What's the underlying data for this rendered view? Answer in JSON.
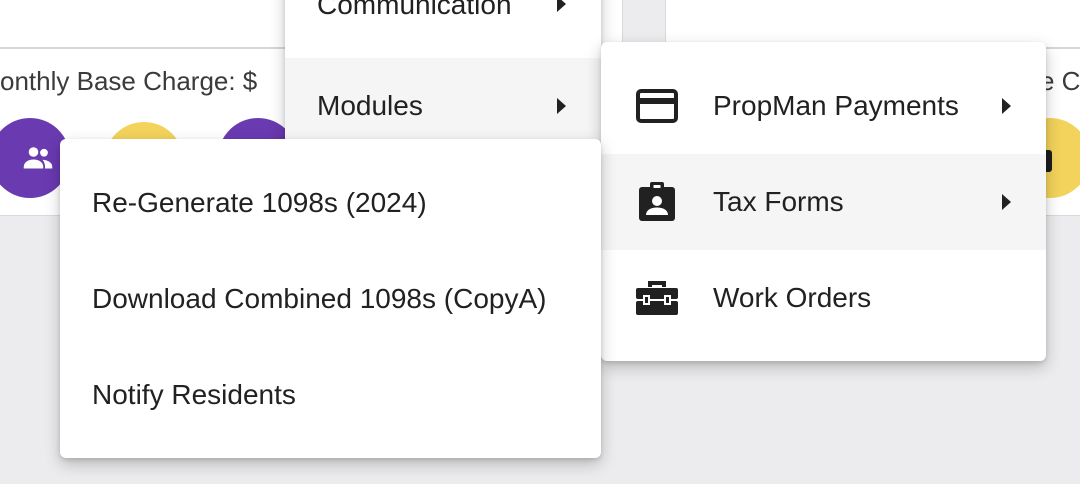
{
  "background": {
    "base_charge_label": "onthly Base Charge: $",
    "base_charge_label_right": "e C"
  },
  "main_menu": {
    "items": [
      {
        "label": "Communication"
      },
      {
        "label": "Modules"
      }
    ]
  },
  "modules_menu": {
    "items": [
      {
        "label": "PropMan Payments",
        "icon": "credit-card-icon"
      },
      {
        "label": "Tax Forms",
        "icon": "id-badge-icon"
      },
      {
        "label": "Work Orders",
        "icon": "toolbox-icon"
      }
    ]
  },
  "tax_forms_menu": {
    "items": [
      {
        "label": "Re-Generate 1098s (2024)"
      },
      {
        "label": "Download Combined 1098s (CopyA)"
      },
      {
        "label": "Notify Residents"
      }
    ]
  },
  "colors": {
    "accent_purple": "#6a3ab1",
    "accent_yellow": "#f3d35c",
    "menu_hover": "#f5f5f5"
  }
}
